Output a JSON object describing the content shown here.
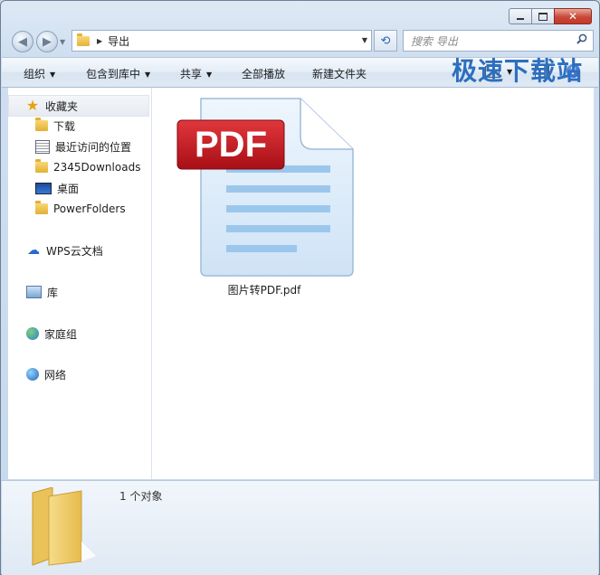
{
  "window": {
    "buttons": {
      "minimize": "minimize",
      "maximize": "maximize",
      "close": "close"
    }
  },
  "address_bar": {
    "path": "导出",
    "search_placeholder": "搜索 导出"
  },
  "toolbar": {
    "organize": "组织",
    "include_in_library": "包含到库中",
    "share": "共享",
    "play_all": "全部播放",
    "new_folder": "新建文件夹"
  },
  "sidebar": {
    "favorites": {
      "label": "收藏夹",
      "items": [
        {
          "label": "下载",
          "icon": "download-folder-icon"
        },
        {
          "label": "最近访问的位置",
          "icon": "recent-places-icon"
        },
        {
          "label": "2345Downloads",
          "icon": "folder-icon"
        },
        {
          "label": "桌面",
          "icon": "desktop-icon"
        },
        {
          "label": "PowerFolders",
          "icon": "folder-icon"
        }
      ]
    },
    "wps_cloud": "WPS云文档",
    "libraries": "库",
    "homegroup": "家庭组",
    "network": "网络"
  },
  "files": [
    {
      "name": "图片转PDF.pdf",
      "icon": "pdf-file-icon",
      "badge_text": "PDF"
    }
  ],
  "details_pane": {
    "item_count": "1 个对象"
  },
  "watermark": "极速下载站",
  "colors": {
    "pdf_badge": "#c0151b",
    "accent": "#2d6fbe"
  }
}
